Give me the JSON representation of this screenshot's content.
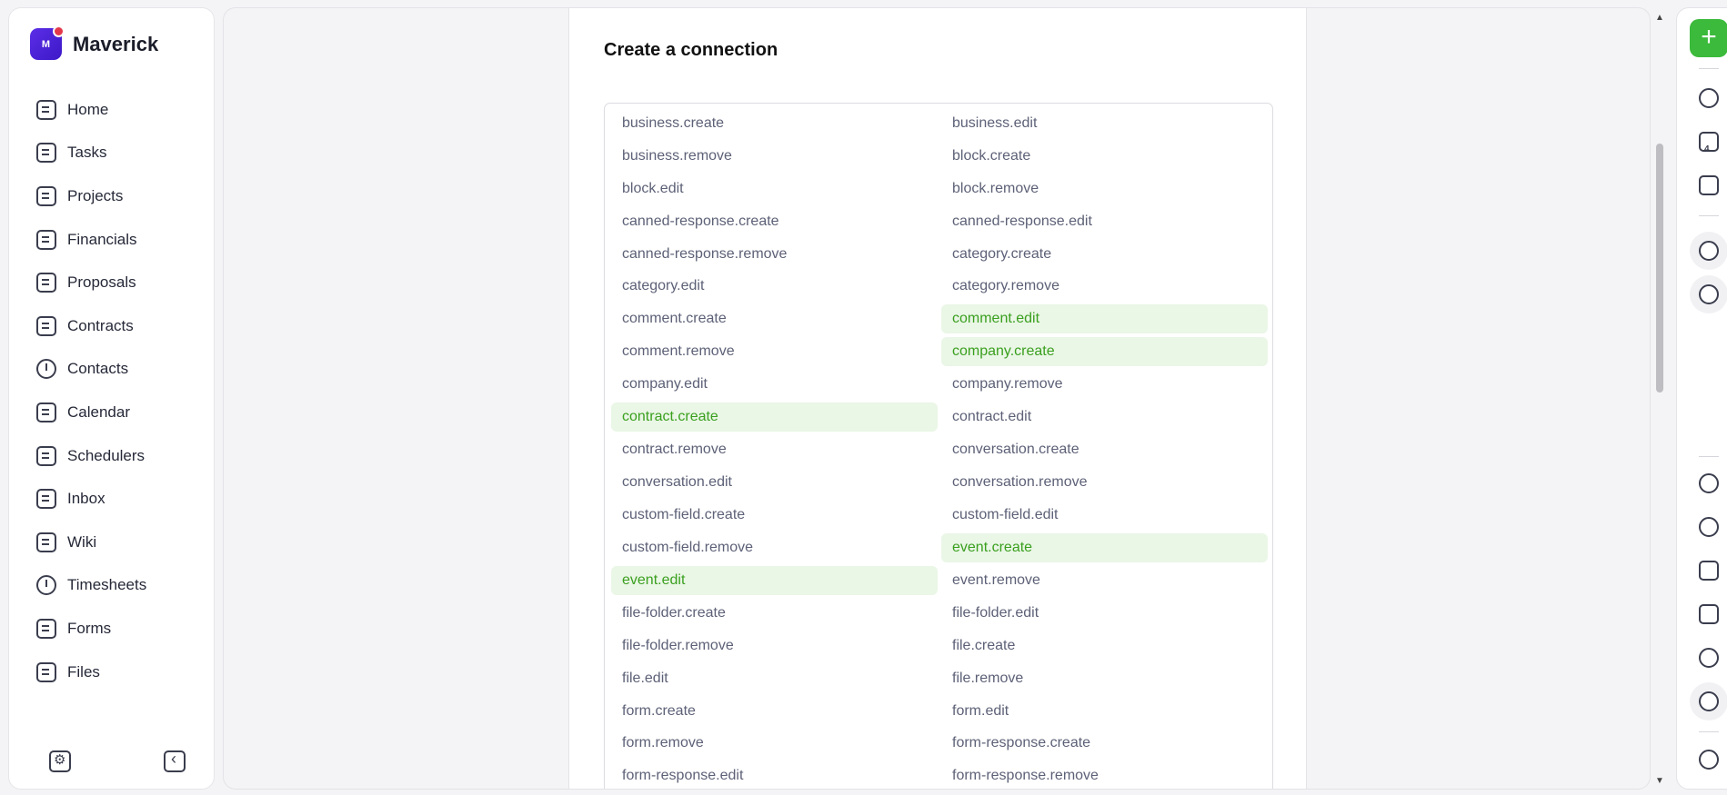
{
  "brand": {
    "name": "Maverick",
    "logo_letter": "M",
    "accent": "#4a22d6",
    "badge_color": "#e4384a"
  },
  "sidebar": {
    "items": [
      {
        "label": "Home",
        "icon": "home-icon"
      },
      {
        "label": "Tasks",
        "icon": "check-square-icon"
      },
      {
        "label": "Projects",
        "icon": "briefcase-icon"
      },
      {
        "label": "Financials",
        "icon": "calculator-icon"
      },
      {
        "label": "Proposals",
        "icon": "pen-icon"
      },
      {
        "label": "Contracts",
        "icon": "contract-icon"
      },
      {
        "label": "Contacts",
        "icon": "people-icon"
      },
      {
        "label": "Calendar",
        "icon": "calendar-icon"
      },
      {
        "label": "Schedulers",
        "icon": "calendar-clock-icon"
      },
      {
        "label": "Inbox",
        "icon": "inbox-icon"
      },
      {
        "label": "Wiki",
        "icon": "book-icon"
      },
      {
        "label": "Timesheets",
        "icon": "clock-icon"
      },
      {
        "label": "Forms",
        "icon": "form-icon"
      },
      {
        "label": "Files",
        "icon": "folder-icon"
      }
    ],
    "bottom": [
      "workspace-settings-icon",
      "collapse-sidebar-icon"
    ]
  },
  "panel": {
    "title": "Create a connection",
    "selected_color": "#3aa01f",
    "selected_bg": "#eaf6e6",
    "events": [
      {
        "label": "business.create",
        "selected": false
      },
      {
        "label": "business.edit",
        "selected": false
      },
      {
        "label": "business.remove",
        "selected": false
      },
      {
        "label": "block.create",
        "selected": false
      },
      {
        "label": "block.edit",
        "selected": false
      },
      {
        "label": "block.remove",
        "selected": false
      },
      {
        "label": "canned-response.create",
        "selected": false
      },
      {
        "label": "canned-response.edit",
        "selected": false
      },
      {
        "label": "canned-response.remove",
        "selected": false
      },
      {
        "label": "category.create",
        "selected": false
      },
      {
        "label": "category.edit",
        "selected": false
      },
      {
        "label": "category.remove",
        "selected": false
      },
      {
        "label": "comment.create",
        "selected": false
      },
      {
        "label": "comment.edit",
        "selected": true
      },
      {
        "label": "comment.remove",
        "selected": false
      },
      {
        "label": "company.create",
        "selected": true
      },
      {
        "label": "company.edit",
        "selected": false
      },
      {
        "label": "company.remove",
        "selected": false
      },
      {
        "label": "contract.create",
        "selected": true
      },
      {
        "label": "contract.edit",
        "selected": false
      },
      {
        "label": "contract.remove",
        "selected": false
      },
      {
        "label": "conversation.create",
        "selected": false
      },
      {
        "label": "conversation.edit",
        "selected": false
      },
      {
        "label": "conversation.remove",
        "selected": false
      },
      {
        "label": "custom-field.create",
        "selected": false
      },
      {
        "label": "custom-field.edit",
        "selected": false
      },
      {
        "label": "custom-field.remove",
        "selected": false
      },
      {
        "label": "event.create",
        "selected": true
      },
      {
        "label": "event.edit",
        "selected": true
      },
      {
        "label": "event.remove",
        "selected": false
      },
      {
        "label": "file-folder.create",
        "selected": false
      },
      {
        "label": "file-folder.edit",
        "selected": false
      },
      {
        "label": "file-folder.remove",
        "selected": false
      },
      {
        "label": "file.create",
        "selected": false
      },
      {
        "label": "file.edit",
        "selected": false
      },
      {
        "label": "file.remove",
        "selected": false
      },
      {
        "label": "form.create",
        "selected": false
      },
      {
        "label": "form.edit",
        "selected": false
      },
      {
        "label": "form.remove",
        "selected": false
      },
      {
        "label": "form-response.create",
        "selected": false
      },
      {
        "label": "form-response.edit",
        "selected": false
      },
      {
        "label": "form-response.remove",
        "selected": false
      }
    ]
  },
  "rail": {
    "add_label": "+",
    "calendar_day": "4",
    "icons": [
      "bell-icon",
      "calendar-icon",
      "notes-icon",
      "add-user-icon",
      "rocket-icon",
      "moon-icon",
      "help-icon",
      "cloud-icon",
      "archive-icon",
      "footprints-icon",
      "settings-icon",
      "profile-icon"
    ],
    "add_color": "#3bba3b"
  }
}
